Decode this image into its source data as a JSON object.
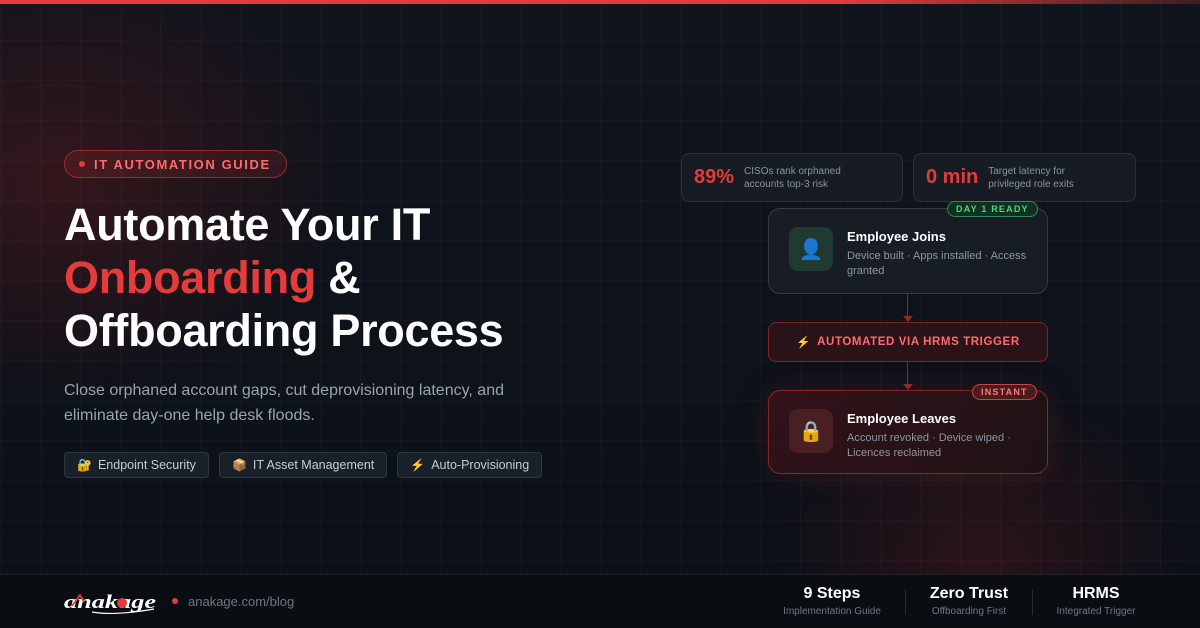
{
  "tag": {
    "label": "IT AUTOMATION GUIDE"
  },
  "headline": {
    "line1": "Automate Your IT",
    "accent": "Onboarding",
    "line2_rest": " &",
    "line3": "Offboarding Process"
  },
  "subtitle": "Close orphaned account gaps, cut deprovisioning latency, and eliminate day-one help desk floods.",
  "chips": [
    {
      "icon": "🔐",
      "icon_name": "lock-key-icon",
      "label": "Endpoint Security"
    },
    {
      "icon": "📦",
      "icon_name": "package-icon",
      "label": "IT Asset Management"
    },
    {
      "icon": "⚡",
      "icon_name": "lightning-icon",
      "label": "Auto-Provisioning"
    }
  ],
  "stats": [
    {
      "value": "89%",
      "label": "CISOs rank orphaned accounts top-3 risk"
    },
    {
      "value": "0 min",
      "label": "Target latency for privileged role exits"
    }
  ],
  "flow": {
    "join": {
      "badge": "DAY 1 READY",
      "icon": "👤",
      "icon_name": "user-icon",
      "title": "Employee Joins",
      "desc": "Device built · Apps installed · Access granted"
    },
    "trigger": {
      "icon": "⚡",
      "label": "AUTOMATED VIA HRMS TRIGGER"
    },
    "leave": {
      "badge": "INSTANT",
      "icon": "🔒",
      "icon_name": "lock-icon",
      "title": "Employee Leaves",
      "desc": "Account revoked · Device wiped · Licences reclaimed"
    }
  },
  "footer": {
    "brand": "anakage",
    "site": "anakage.com/blog",
    "stats": [
      {
        "value": "9 Steps",
        "label": "Implementation Guide"
      },
      {
        "value": "Zero Trust",
        "label": "Offboarding First"
      },
      {
        "value": "HRMS",
        "label": "Integrated Trigger"
      }
    ]
  },
  "colors": {
    "accent": "#e53b3b",
    "success": "#4fd08a",
    "background": "#0d1118"
  }
}
